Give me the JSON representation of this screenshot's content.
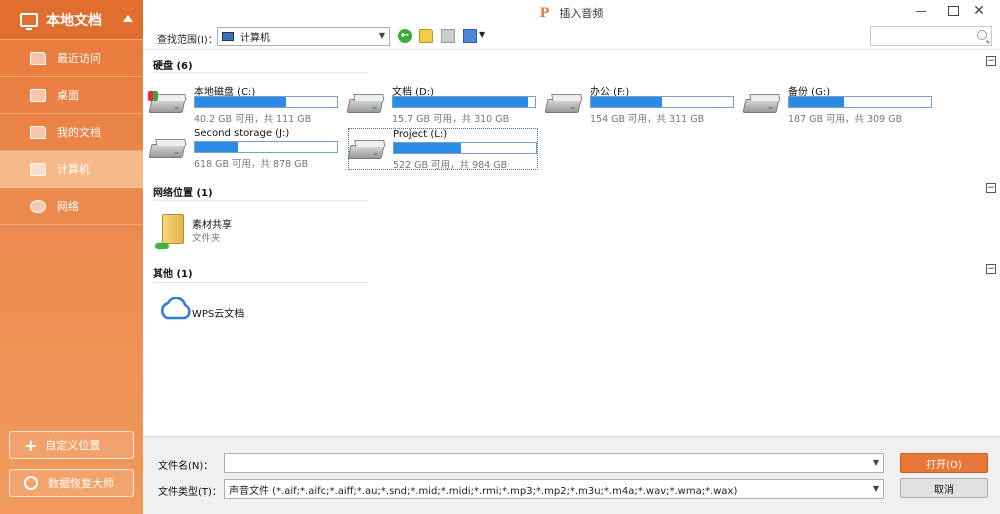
{
  "sidebar": {
    "header": "本地文档",
    "items": [
      {
        "label": "最近访问",
        "icon": "recent-icon"
      },
      {
        "label": "桌面",
        "icon": "desktop-icon"
      },
      {
        "label": "我的文档",
        "icon": "folder-icon"
      },
      {
        "label": "计算机",
        "icon": "computer-icon",
        "active": true
      },
      {
        "label": "网络",
        "icon": "network-icon"
      }
    ],
    "custom_location": "自定义位置",
    "recovery": "数据恢复大师"
  },
  "window": {
    "logo": "P",
    "title": "插入音频"
  },
  "toolbar": {
    "scope_label": "查找范围(I)：",
    "scope_value": "计算机"
  },
  "groups": {
    "disks": {
      "title": "硬盘 (6)"
    },
    "network": {
      "title": "网络位置 (1)"
    },
    "other": {
      "title": "其他 (1)"
    }
  },
  "drives": [
    {
      "name": "本地磁盘 (C:)",
      "size": "40.2 GB 可用，共 111 GB",
      "used_fraction": 0.64
    },
    {
      "name": "文档 (D:)",
      "size": "15.7 GB 可用，共 310 GB",
      "used_fraction": 0.95
    },
    {
      "name": "办公 (F:)",
      "size": "154 GB 可用，共 311 GB",
      "used_fraction": 0.5
    },
    {
      "name": "备份 (G:)",
      "size": "187 GB 可用，共 309 GB",
      "used_fraction": 0.39
    },
    {
      "name": "Second storage (J:)",
      "size": "618 GB 可用，共 878 GB",
      "used_fraction": 0.3
    },
    {
      "name": "Project (L:)",
      "size": "522 GB 可用，共 984 GB",
      "used_fraction": 0.47
    }
  ],
  "network_item": {
    "name": "素材共享",
    "sub": "文件夹"
  },
  "cloud_item": {
    "name": "WPS云文档"
  },
  "bottom": {
    "filename_label": "文件名(N)：",
    "filename_value": "",
    "filetype_label": "文件类型(T)：",
    "filetype_value": "声音文件 (*.aif;*.aifc;*.aiff;*.au;*.snd;*.mid;*.midi;*.rmi;*.mp3;*.mp2;*.m3u;*.m4a;*.wav;*.wma;*.wax)",
    "open_label": "打开(O)",
    "cancel_label": "取消"
  },
  "colors": {
    "accent": "#e8783a",
    "bar_fill": "#2b8be6"
  }
}
